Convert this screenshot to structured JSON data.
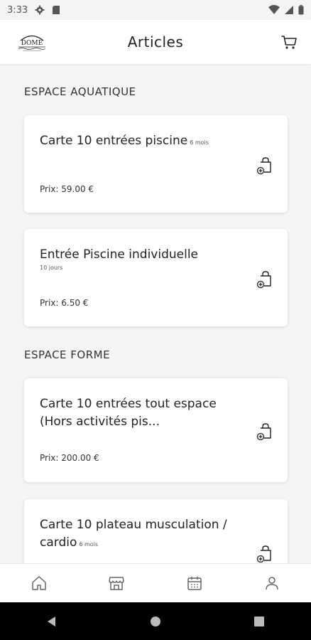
{
  "status_bar": {
    "time": "3:33"
  },
  "header": {
    "title": "Articles"
  },
  "sections": [
    {
      "title": "ESPACE AQUATIQUE",
      "items": [
        {
          "name": "Carte 10 entrées piscine",
          "duration": "6 mois",
          "price": "Prix: 59.00 €"
        },
        {
          "name": "Entrée Piscine individuelle",
          "duration": "10 jours",
          "price": "Prix: 6.50 €"
        }
      ]
    },
    {
      "title": "ESPACE FORME",
      "items": [
        {
          "name": "Carte 10 entrées tout espace (Hors activités pis...",
          "duration": "",
          "price": "Prix: 200.00 €"
        },
        {
          "name": "Carte 10 plateau musculation / cardio",
          "duration": "6 mois",
          "price": ""
        }
      ]
    }
  ],
  "colors": {
    "background": "#f4f4f4",
    "card": "#ffffff",
    "text": "#222222"
  }
}
